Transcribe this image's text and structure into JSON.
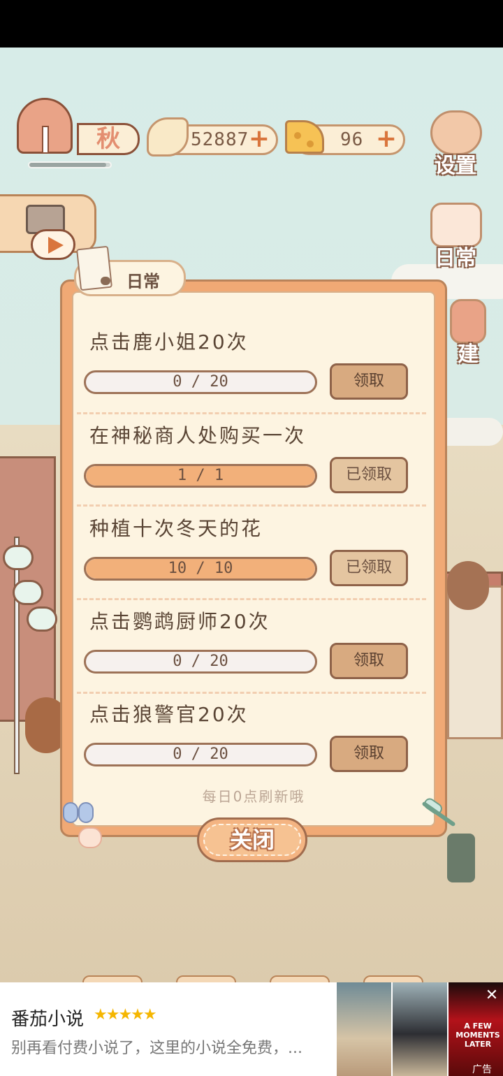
{
  "hud": {
    "season": "秋",
    "season_progress": 0.95,
    "fish_count": "52887",
    "cheese_count": "96"
  },
  "side_buttons": {
    "settings": "设置",
    "daily": "日常",
    "build": "建"
  },
  "daily_panel": {
    "tab_label": "日常",
    "tasks": [
      {
        "title": "点击鹿小姐20次",
        "progress_text": "0 / 20",
        "progress": 0.0,
        "button": "领取"
      },
      {
        "title": "在神秘商人处购买一次",
        "progress_text": "1 / 1",
        "progress": 1.0,
        "button": "已领取"
      },
      {
        "title": "种植十次冬天的花",
        "progress_text": "10 / 10",
        "progress": 1.0,
        "button": "已领取"
      },
      {
        "title": "点击鹦鹉厨师20次",
        "progress_text": "0 / 20",
        "progress": 0.0,
        "button": "领取"
      },
      {
        "title": "点击狼警官20次",
        "progress_text": "0 / 20",
        "progress": 0.0,
        "button": "领取"
      }
    ],
    "refresh_note": "每日0点刷新哦",
    "close_label": "关闭"
  },
  "ad": {
    "title": "番茄小说",
    "stars": "★★★★★",
    "description": "别再看付费小说了，这里的小说全免费，...",
    "movie_text": "A FEW MOMENTS LATER",
    "tag": "广告",
    "close": "✕"
  },
  "colors": {
    "panel_orange": "#f0a975",
    "panel_cream": "#fdf4e1",
    "progress_fill": "#f2b07a",
    "accent_plus": "#d9753d"
  }
}
